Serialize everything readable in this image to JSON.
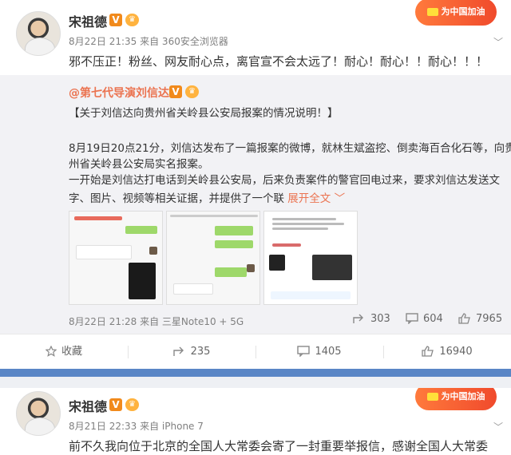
{
  "post1": {
    "username": "宋祖德",
    "meta": "8月22日 21:35 来自 360安全浏览器",
    "support_badge": "为中国加油",
    "text": "邪不压正！粉丝、网友耐心点，离官宣不会太远了！耐心！耐心！！耐心！！！",
    "repost": {
      "user": "@第七代导演刘信达",
      "title": "【关于刘信达向贵州省关岭县公安局报案的情况说明！】",
      "lines": [
        "8月19日20点21分，刘信达发布了一篇报案的微博，就林生斌盗挖、倒卖海百合化石等，向贵",
        "州省关岭县公安局实名报案。",
        "一开始是刘信达打电话到关岭县公安局，后来负责案件的警官回电过来，要求刘信达发送文",
        "字、图片、视频等相关证据，并提供了一个联 "
      ],
      "expand": "展开全文 ﹀",
      "footer": "8月22日 21:28 来自 三星Note10 + 5G",
      "repost_count": "303",
      "comment_count": "604",
      "like_count": "7965"
    },
    "actions": {
      "favorite": "收藏",
      "repost": "235",
      "comment": "1405",
      "like": "16940"
    }
  },
  "post2": {
    "username": "宋祖德",
    "meta": "8月21日 22:33 来自 iPhone 7",
    "support_badge": "为中国加油",
    "text": "前不久我向位于北京的全国人大常委会寄了一封重要举报信，感谢全国人大常委"
  },
  "colors": {
    "accent": "#eb7350",
    "divider": "#5a86c6",
    "repost_bg": "#f2f2f5"
  }
}
